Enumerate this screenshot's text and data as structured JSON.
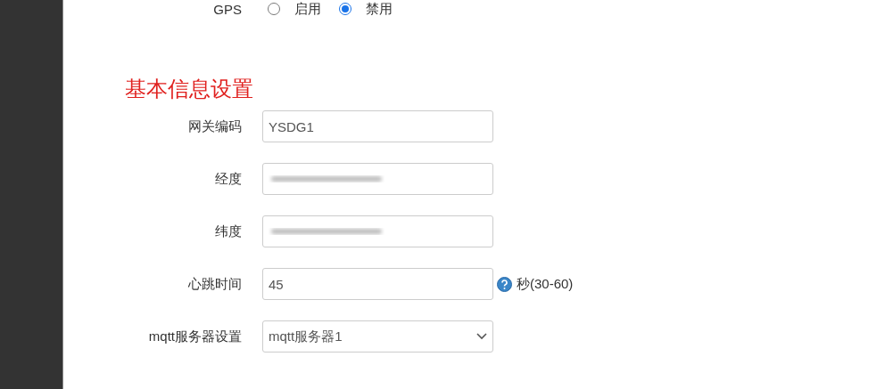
{
  "gps": {
    "label": "GPS",
    "options": [
      {
        "label": "启用",
        "selected": false
      },
      {
        "label": "禁用",
        "selected": true
      }
    ]
  },
  "section_title": "基本信息设置",
  "fields": [
    {
      "kind": "text",
      "label": "网关编码",
      "value": "YSDG1"
    },
    {
      "kind": "blurred",
      "label": "经度"
    },
    {
      "kind": "blurred",
      "label": "纬度"
    },
    {
      "kind": "text",
      "label": "心跳时间",
      "value": "45",
      "hint": "秒(30-60)"
    },
    {
      "kind": "select",
      "label": "mqtt服务器设置",
      "value": "mqtt服务器1"
    }
  ]
}
